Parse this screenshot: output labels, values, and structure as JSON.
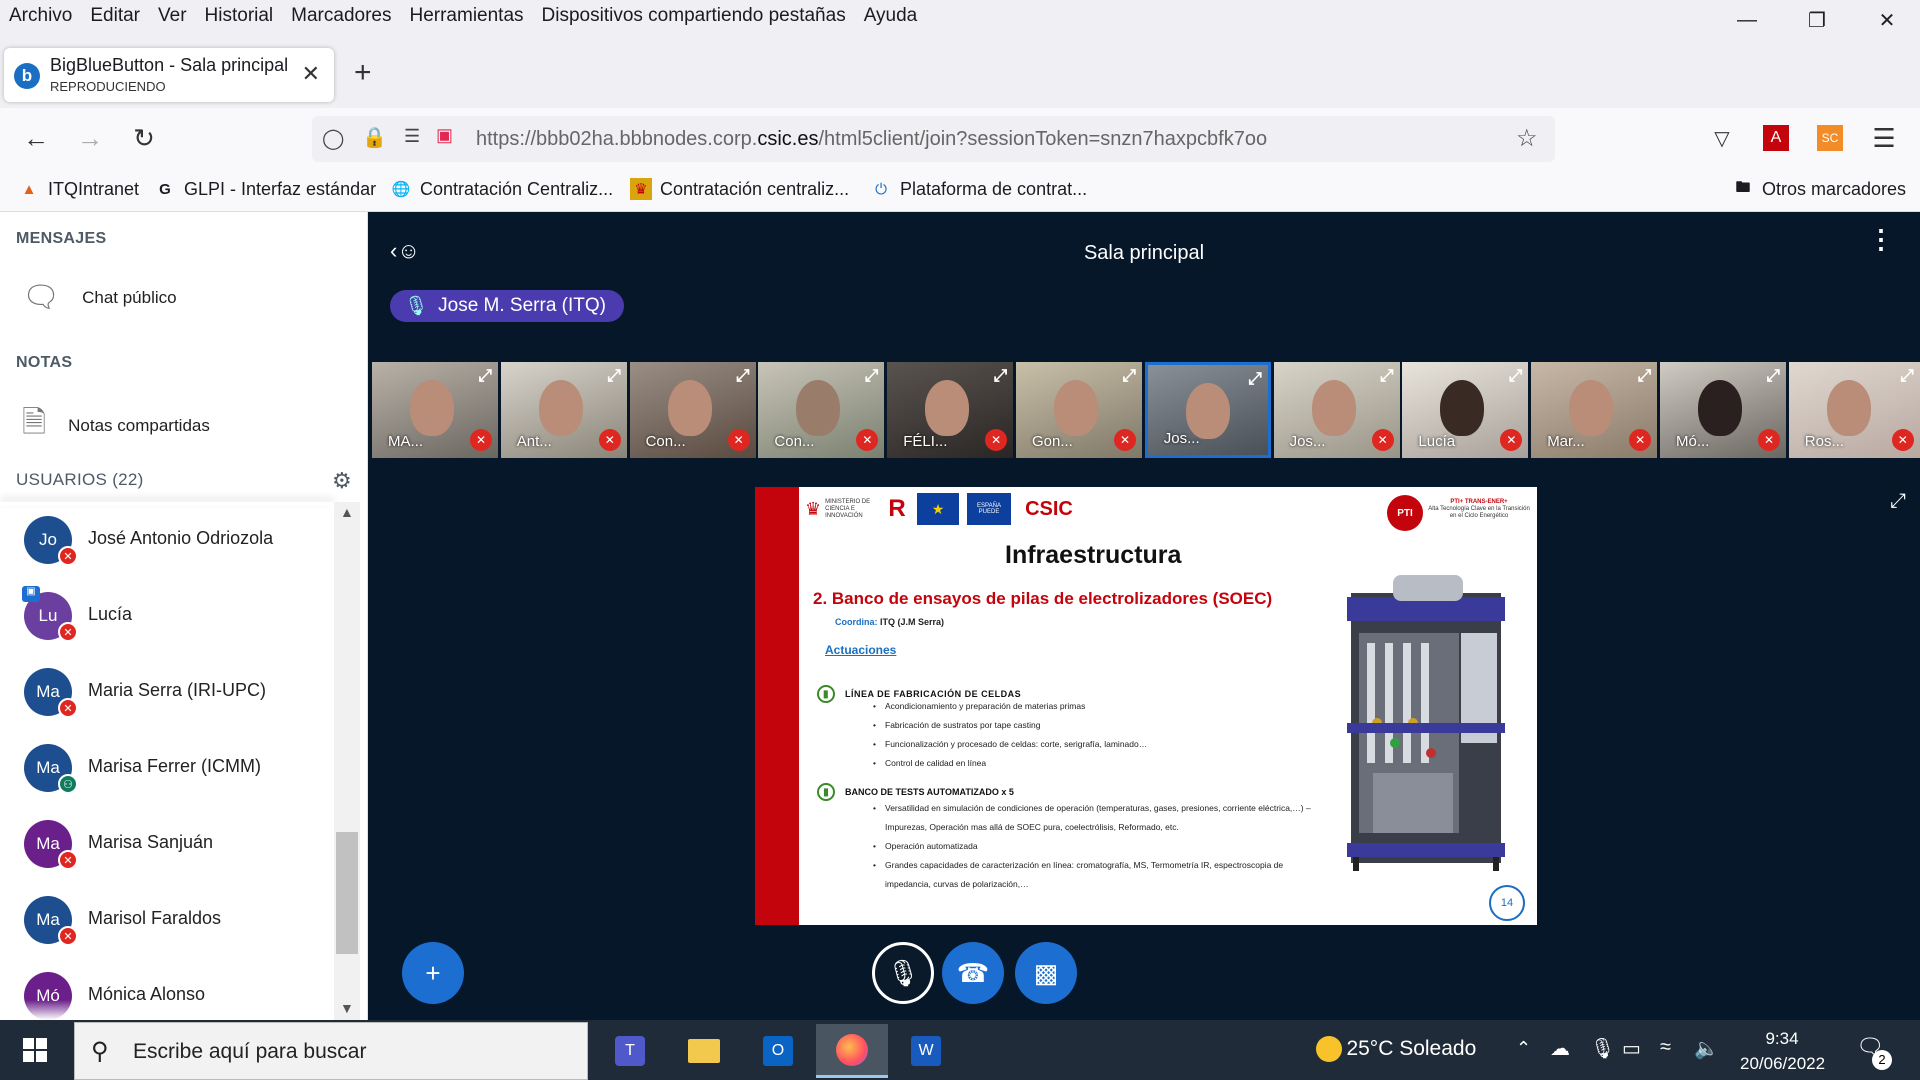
{
  "menubar": [
    "Archivo",
    "Editar",
    "Ver",
    "Historial",
    "Marcadores",
    "Herramientas",
    "Dispositivos compartiendo pestañas",
    "Ayuda"
  ],
  "tab": {
    "title": "BigBlueButton - Sala principal",
    "subtitle": "REPRODUCIENDO",
    "favicon_letter": "b"
  },
  "url": {
    "prefix": "https://bbb02ha.bbbnodes.corp.",
    "domain": "csic.es",
    "suffix": "/html5client/join?sessionToken=snzn7haxpcbfk7oo"
  },
  "bookmarks": [
    {
      "label": "ITQIntranet",
      "icon": "flame-icon"
    },
    {
      "label": "GLPI - Interfaz estándar",
      "icon": "glpi-g-icon"
    },
    {
      "label": "Contratación Centraliz...",
      "icon": "globe-icon"
    },
    {
      "label": "Contratación centraliz...",
      "icon": "shield-emblem-icon"
    },
    {
      "label": "Plataforma de contrat...",
      "icon": "power-icon"
    }
  ],
  "other_bookmarks": "Otros marcadores",
  "sidebar": {
    "messages_header": "MENSAJES",
    "public_chat": "Chat público",
    "notes_header": "NOTAS",
    "shared_notes": "Notas compartidas",
    "users_header": "USUARIOS (22)",
    "users": [
      {
        "initials": "Jo",
        "name": "José Antonio Odriozola",
        "color": "#1d4e8f",
        "status": "muted"
      },
      {
        "initials": "Lu",
        "name": "Lucía",
        "color": "#6b3fa0",
        "status": "muted",
        "presenter": true
      },
      {
        "initials": "Ma",
        "name": "Maria Serra (IRI-UPC)",
        "color": "#1d4e8f",
        "status": "muted"
      },
      {
        "initials": "Ma",
        "name": "Marisa Ferrer (ICMM)",
        "color": "#1d4e8f",
        "status": "listen"
      },
      {
        "initials": "Ma",
        "name": "Marisa Sanjuán",
        "color": "#6b1f8a",
        "status": "muted"
      },
      {
        "initials": "Ma",
        "name": "Marisol Faraldos",
        "color": "#1d4e8f",
        "status": "muted"
      },
      {
        "initials": "Mó",
        "name": "Mónica Alonso",
        "color": "#6b1f8a",
        "status": "muted"
      }
    ]
  },
  "room_title": "Sala principal",
  "talker": "Jose M. Serra (ITQ)",
  "video_tiles": [
    "MA...",
    "Ant...",
    "Con...",
    "Con...",
    "FÉLI...",
    "Gon...",
    "Jos...",
    "Jos...",
    "Lucía",
    "Mar...",
    "Mó...",
    "Ros..."
  ],
  "slide": {
    "title": "Infraestructura",
    "subtitle": "2. Banco de ensayos de pilas de electrolizadores (SOEC)",
    "coord_label": "Coordina:",
    "coord_value": "ITQ (J.M Serra)",
    "actuaciones": "Actuaciones",
    "logos": [
      "MINISTERIO DE CIENCIA E INNOVACIÓN",
      "R",
      "Financiado por la Unión Europea",
      "ESPAÑA PUEDE",
      "CSIC"
    ],
    "pti_brand": "PTI+ TRANS-ENER+",
    "pti_tag": "Alta Tecnología Clave en la Transición en el Ciclo Energético",
    "section1": "LÍNEA DE FABRICACIÓN DE CELDAS",
    "section1_items": [
      "Acondicionamiento y preparación de materias primas",
      "Fabricación de sustratos por tape casting",
      "Funcionalización y procesado de celdas: corte, serigrafía, laminado…",
      "Control de calidad en línea"
    ],
    "section2": "BANCO DE TESTS AUTOMATIZADO x 5",
    "section2_items": [
      "Versatilidad en simulación de condiciones de operación (temperaturas, gases, presiones, corriente eléctrica,…) – Impurezas, Operación mas allá de SOEC pura, coelectrólisis, Reformado, etc.",
      "Operación automatizada",
      "Grandes capacidades de caracterización en línea: cromatografía, MS, Termometría IR, espectroscopia de impedancia, curvas de polarización,…"
    ],
    "page": "14"
  },
  "taskbar": {
    "search_placeholder": "Escribe aquí para buscar",
    "weather": "25°C  Soleado",
    "time": "9:34",
    "date": "20/06/2022",
    "notif_count": "2"
  }
}
